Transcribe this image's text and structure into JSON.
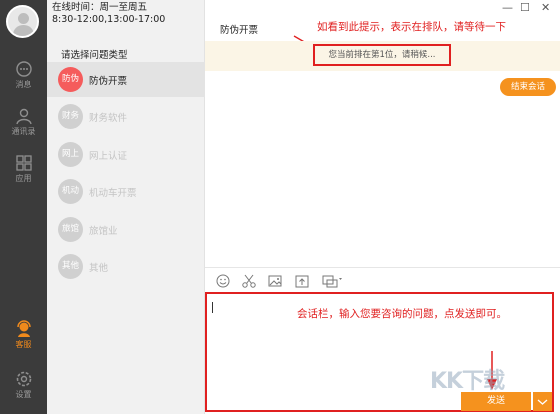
{
  "sidebar": {
    "items": [
      {
        "icon": "chat-bubble-icon",
        "label": "消息"
      },
      {
        "icon": "contacts-icon",
        "label": "通讯录"
      },
      {
        "icon": "apps-grid-icon",
        "label": "应用"
      },
      {
        "icon": "customer-service-icon",
        "label": "客服"
      },
      {
        "icon": "gear-icon",
        "label": "设置"
      }
    ],
    "accent": "#f08a1c"
  },
  "panel": {
    "online_line1": "在线时间：周一至周五",
    "online_line2": "8:30-12:00,13:00-17:00",
    "title": "请选择问题类型",
    "categories": [
      {
        "badge": "防伪",
        "name": "防伪开票"
      },
      {
        "badge": "财务",
        "name": "财务软件"
      },
      {
        "badge": "网上",
        "name": "网上认证"
      },
      {
        "badge": "机动",
        "name": "机动车开票"
      },
      {
        "badge": "旅馆",
        "name": "旅馆业"
      },
      {
        "badge": "其他",
        "name": "其他"
      }
    ],
    "active_color": "#f55c5c"
  },
  "window": {
    "minimize": "—",
    "maximize": "☐",
    "close": "✕"
  },
  "chat": {
    "title": "防伪开票",
    "annotation_top": "如看到此提示，表示在排队，请等待一下",
    "queue_notice": "您当前排在第1位，请稍候...",
    "end_button": "结束会话",
    "input_value": "",
    "annotation_input": "会话栏，输入您要咨询的问题，点发送即可。",
    "send_button": "发送"
  },
  "toolbar": {
    "tools": [
      "emoji-icon",
      "scissors-icon",
      "image-icon",
      "upload-icon",
      "screenshot-icon"
    ]
  },
  "watermark": "KK下载",
  "colors": {
    "orange": "#f5921e",
    "annotation_red": "#e02020",
    "notice_bg": "#fbf5e6"
  }
}
